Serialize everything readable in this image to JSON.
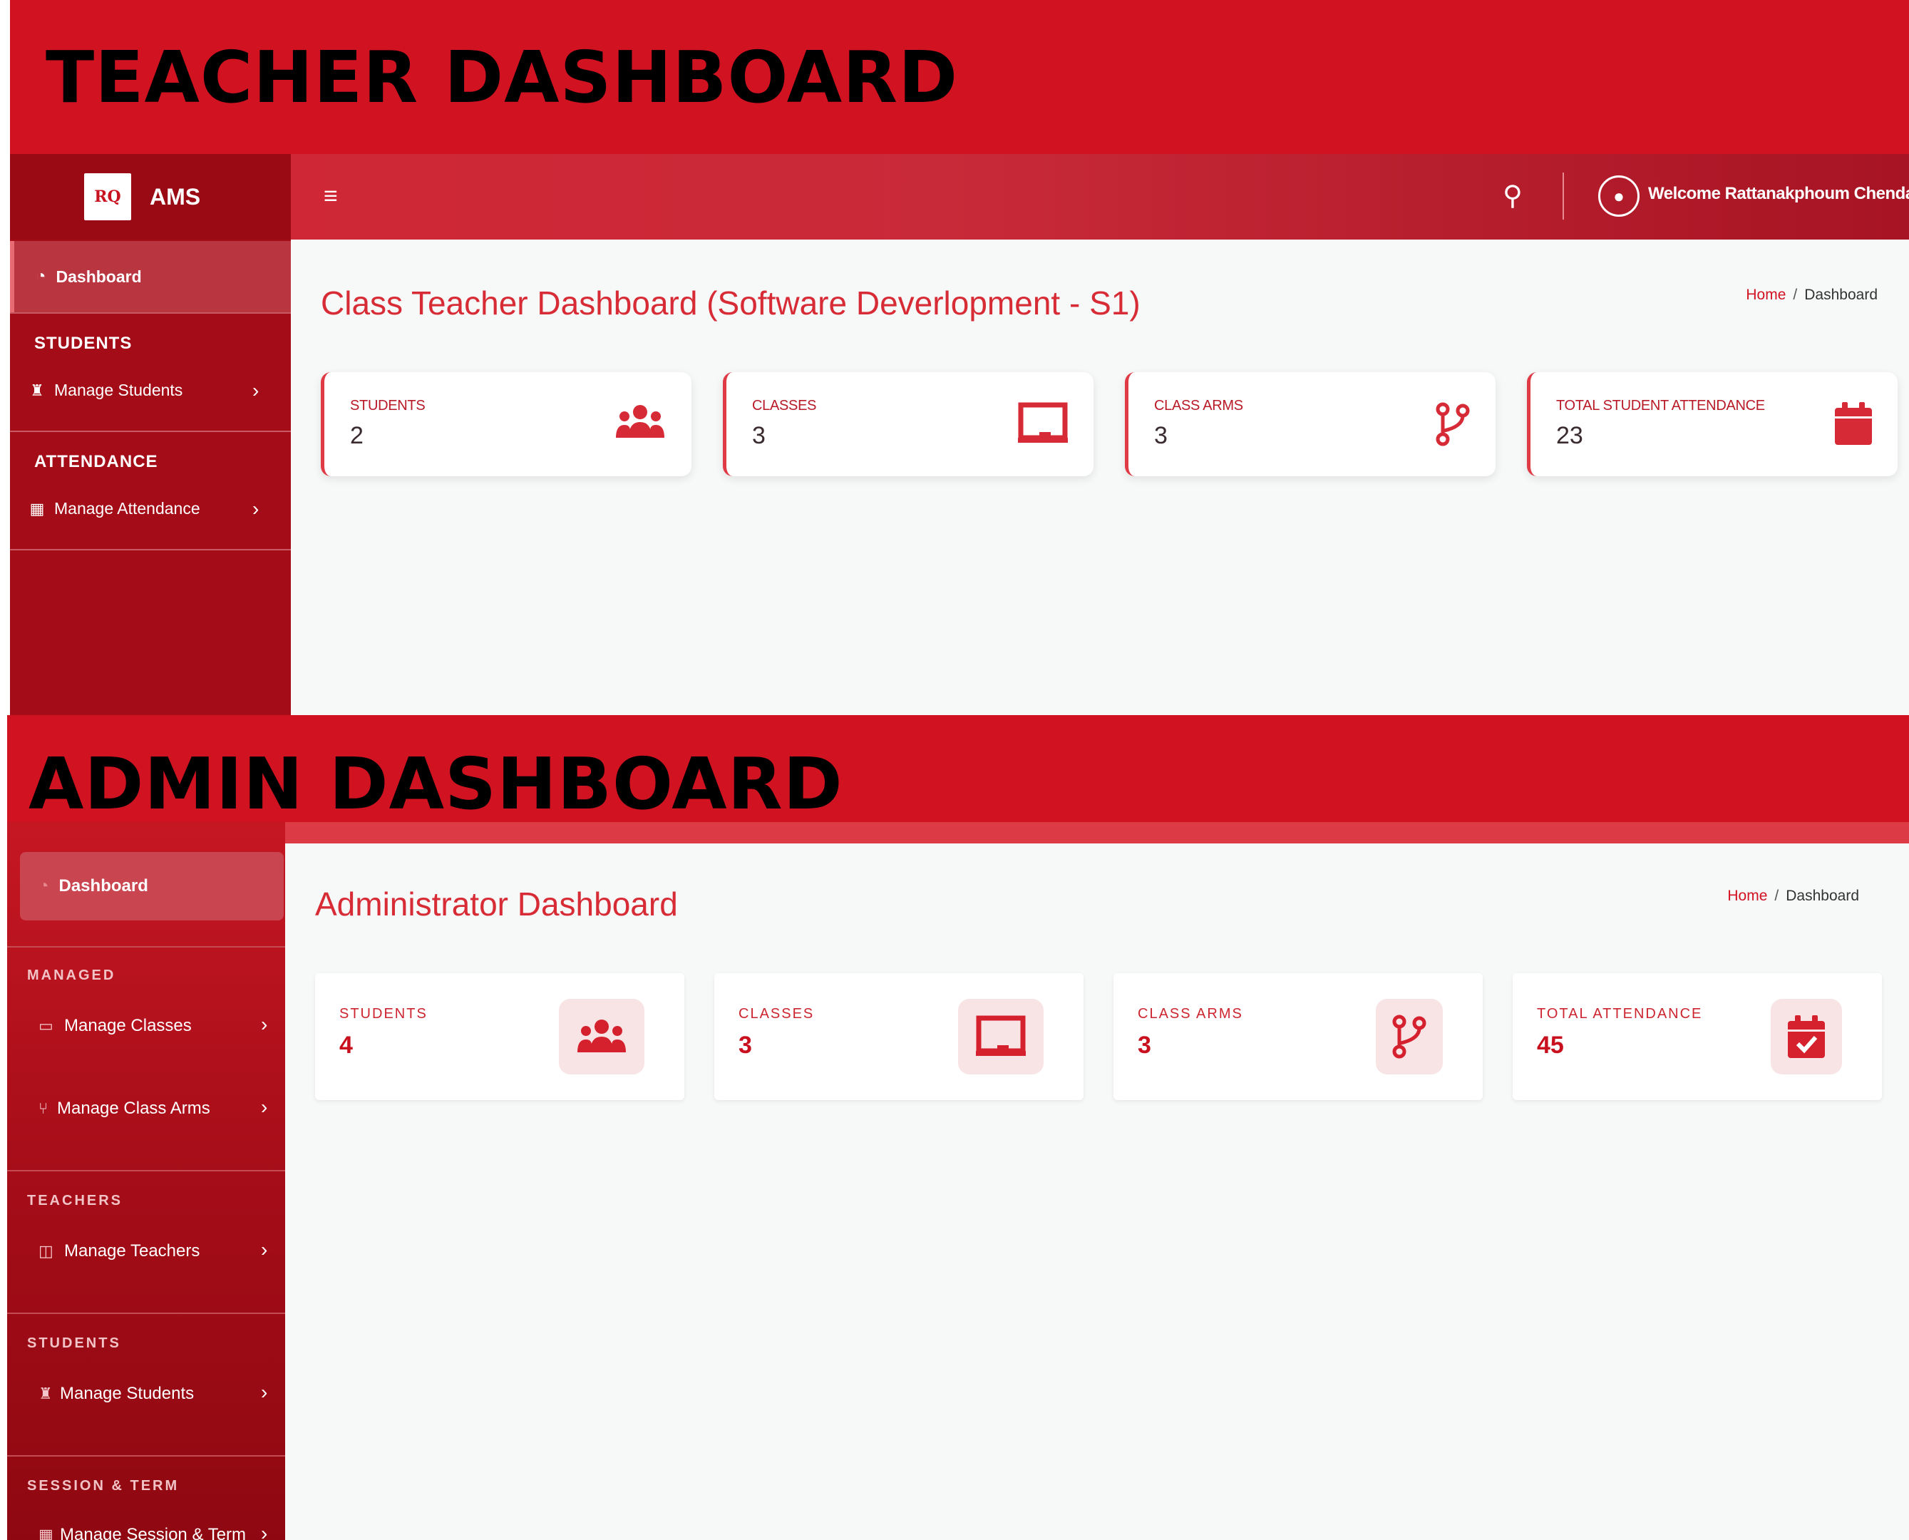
{
  "teacher": {
    "banner_title": "TEACHER DASHBOARD",
    "brand": {
      "logo_text": "RQ",
      "name": "AMS"
    },
    "topbar": {
      "welcome": "Welcome Rattanakphoum Chenda"
    },
    "sidebar": {
      "dashboard": "Dashboard",
      "sections": [
        {
          "title": "STUDENTS",
          "item": "Manage Students"
        },
        {
          "title": "ATTENDANCE",
          "item": "Manage Attendance"
        }
      ]
    },
    "page_title": "Class Teacher Dashboard (Software Deverlopment - S1)",
    "breadcrumb": {
      "home": "Home",
      "sep": "/",
      "current": "Dashboard"
    },
    "cards": [
      {
        "label": "STUDENTS",
        "value": "2",
        "icon": "users-icon"
      },
      {
        "label": "CLASSES",
        "value": "3",
        "icon": "chalkboard-icon"
      },
      {
        "label": "CLASS ARMS",
        "value": "3",
        "icon": "code-branch-icon"
      },
      {
        "label": "TOTAL STUDENT ATTENDANCE",
        "value": "23",
        "icon": "calendar-icon"
      }
    ]
  },
  "admin": {
    "banner_title": "ADMIN DASHBOARD",
    "sidebar": {
      "dashboard": "Dashboard",
      "sections": [
        {
          "title": "MANAGED",
          "items": [
            "Manage Classes",
            "Manage Class Arms"
          ]
        },
        {
          "title": "TEACHERS",
          "items": [
            "Manage Teachers"
          ]
        },
        {
          "title": "STUDENTS",
          "items": [
            "Manage Students"
          ]
        },
        {
          "title": "SESSION & TERM",
          "items": [
            "Manage Session & Term"
          ]
        }
      ]
    },
    "page_title": "Administrator Dashboard",
    "breadcrumb": {
      "home": "Home",
      "sep": "/",
      "current": "Dashboard"
    },
    "cards": [
      {
        "label": "STUDENTS",
        "value": "4",
        "icon": "users-icon"
      },
      {
        "label": "CLASSES",
        "value": "3",
        "icon": "chalkboard-icon"
      },
      {
        "label": "CLASS ARMS",
        "value": "3",
        "icon": "code-branch-icon"
      },
      {
        "label": "TOTAL ATTENDANCE",
        "value": "45",
        "icon": "calendar-check-icon"
      }
    ]
  },
  "colors": {
    "banner": "#d11221",
    "sidebar": "#a40d17",
    "accent": "#d72b35",
    "background": "#f7f8f8"
  }
}
